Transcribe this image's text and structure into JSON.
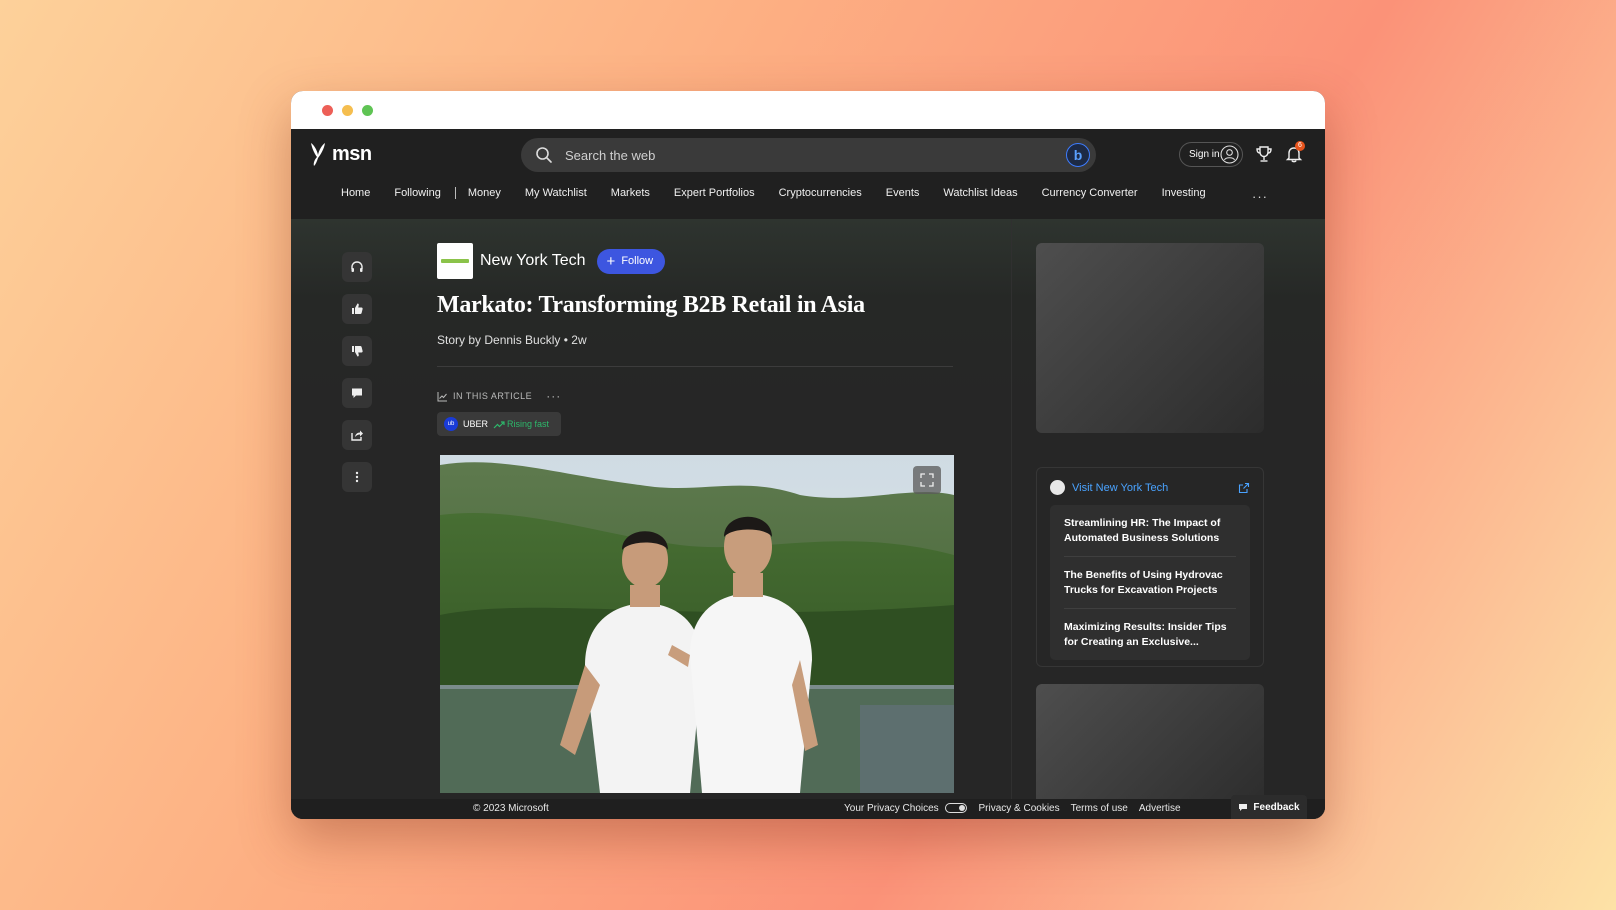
{
  "window": {
    "controls": [
      "close",
      "minimize",
      "maximize"
    ]
  },
  "header": {
    "logo_text": "msn",
    "search_placeholder": "Search the web",
    "signin_label": "Sign in",
    "notification_count": "6"
  },
  "nav": {
    "items": [
      "Home",
      "Following",
      "Money",
      "My Watchlist",
      "Markets",
      "Expert Portfolios",
      "Cryptocurrencies",
      "Events",
      "Watchlist Ideas",
      "Currency Converter",
      "Investing"
    ],
    "more": "···"
  },
  "article": {
    "publisher": "New York Tech",
    "follow_label": "Follow",
    "headline": "Markato: Transforming B2B Retail in Asia",
    "byline": "Story by Dennis Buckly",
    "age": "• 2w",
    "in_article_label": "IN THIS ARTICLE",
    "in_article_more": "···",
    "ticker": {
      "symbol": "UBER",
      "trend": "Rising fast"
    }
  },
  "sidebar": {
    "visit_label": "Visit New York Tech",
    "related": [
      "Streamlining HR: The Impact of Automated Business Solutions",
      "The Benefits of Using Hydrovac Trucks for Excavation Projects",
      "Maximizing Results: Insider Tips for Creating an Exclusive..."
    ]
  },
  "footer": {
    "copyright": "© 2023 Microsoft",
    "links": [
      "Your Privacy Choices",
      "Privacy & Cookies",
      "Terms of use",
      "Advertise"
    ],
    "feedback": "Feedback"
  },
  "colors": {
    "accent": "#3d56e0",
    "link": "#4aa3ff",
    "rising": "#2db86b",
    "badge": "#e8541c"
  }
}
